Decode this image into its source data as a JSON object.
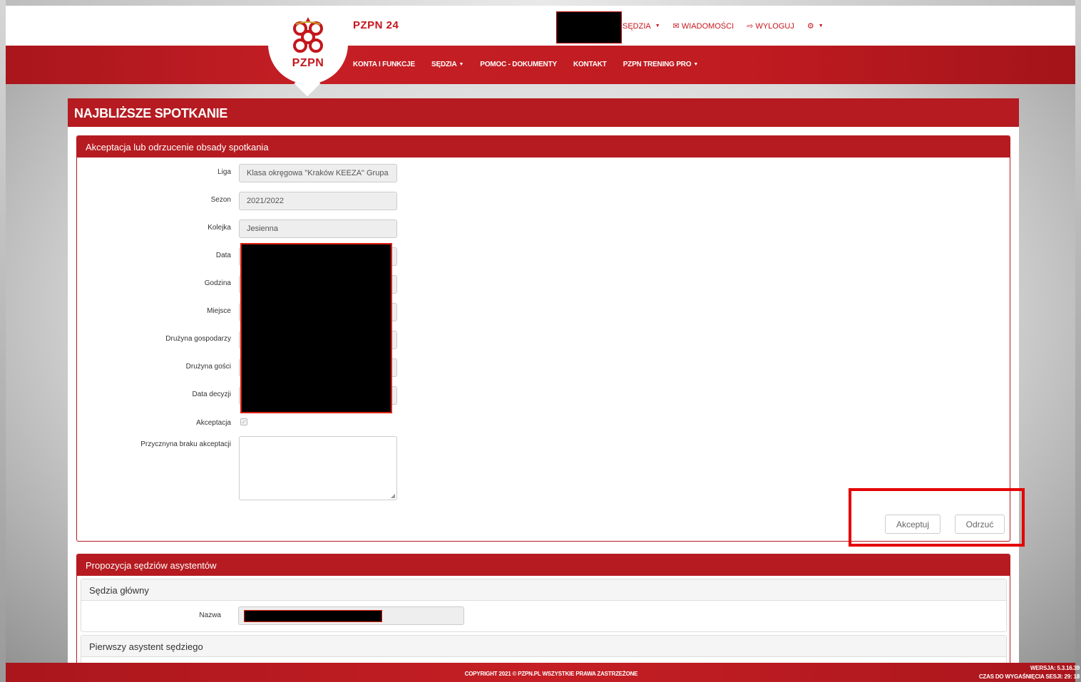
{
  "brand": {
    "logo_text": "PZPN",
    "title": "PZPN 24"
  },
  "top_links": {
    "sedzia": "SĘDZIA",
    "wiadomosci": "WIADOMOŚCI",
    "wyloguj": "WYLOGUJ"
  },
  "main_menu": {
    "items": [
      "KONTA I FUNKCJE",
      "SĘDZIA",
      "POMOC - DOKUMENTY",
      "KONTAKT",
      "PZPN TRENING PRO"
    ]
  },
  "page": {
    "heading": "NAJBLIŻSZE SPOTKANIE"
  },
  "acceptance": {
    "title": "Akceptacja lub odrzucenie obsady spotkania",
    "fields": [
      {
        "label": "Liga",
        "value": "Klasa okręgowa \"Kraków KEEZA\" Grupa"
      },
      {
        "label": "Sezon",
        "value": "2021/2022"
      },
      {
        "label": "Kolejka",
        "value": "Jesienna"
      },
      {
        "label": "Data",
        "value": ""
      },
      {
        "label": "Godzina",
        "value": ""
      },
      {
        "label": "Miejsce",
        "value": ""
      },
      {
        "label": "Drużyna gospodarzy",
        "value": ""
      },
      {
        "label": "Drużyna gości",
        "value": ""
      },
      {
        "label": "Data decyzji",
        "value": ""
      }
    ],
    "akceptacja_label": "Akceptacja",
    "reason_label": "Przycznyna braku akceptacji",
    "accept_button": "Akceptuj",
    "reject_button": "Odrzuć"
  },
  "assistants": {
    "title": "Propozycja sędziów asystentów",
    "main_referee": "Sędzia główny",
    "name_label": "Nazwa",
    "first_assistant": "Pierwszy asystent sędziego"
  },
  "footer": {
    "copyright": "COPYRIGHT 2021 © PZPN.PL WSZYSTKIE PRAWA ZASTRZEŻONE",
    "version": "WERSJA: 5.3.16.39",
    "session": "CZAS DO WYGAŚNIĘCIA SESJI: 29: 18"
  },
  "colors": {
    "brand_red": "#b51b20",
    "highlight": "#e50000"
  }
}
